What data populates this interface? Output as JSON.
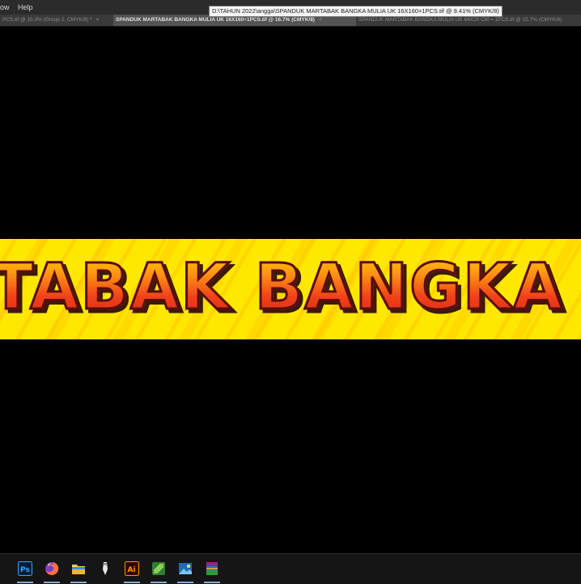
{
  "menubar": {
    "items": [
      {
        "label": "ow"
      },
      {
        "label": "Help"
      }
    ]
  },
  "tooltip": {
    "text": "D:\\TAHUN 2022\\angga\\SPANDUK MARTABAK BANGKA MULIA UK 16X160=1PCS.tif @ 9.41% (CMYK/8)"
  },
  "tabs": [
    {
      "label": "PCS.tif @ 15.3% (Group 2, CMYK/8) *",
      "close": "×",
      "active": false
    },
    {
      "label": "SPANDUK MARTABAK BANGKA MULIA UK 16X160=1PCS.tif @ 16.7% (CMYK/8)",
      "close": "×",
      "active": true
    },
    {
      "label": "SPANDUK MARTABAK BANGKA MULIA UK 64X20 CM = 1PCS.tif @ 15.7% (CMYK/8)",
      "close": "",
      "active": false
    }
  ],
  "banner": {
    "text": "TABAK BANGKA M"
  },
  "taskbar": {
    "apps": [
      {
        "icon": "photoshop-icon",
        "glyph": "Ps",
        "color": "#31a8ff"
      },
      {
        "icon": "firefox-icon",
        "glyph": "",
        "color": "#ff7139"
      },
      {
        "icon": "file-explorer-icon",
        "glyph": "",
        "color": "#f7c948"
      },
      {
        "icon": "pen-tool-icon",
        "glyph": "",
        "color": "#dddddd"
      },
      {
        "icon": "illustrator-icon",
        "glyph": "Ai",
        "color": "#ff9a00"
      },
      {
        "icon": "coreldraw-icon",
        "glyph": "",
        "color": "#6cc04a"
      },
      {
        "icon": "image-viewer-icon",
        "glyph": "",
        "color": "#4aa3e0"
      },
      {
        "icon": "winrar-icon",
        "glyph": "",
        "color": "#b23a8a"
      }
    ]
  }
}
